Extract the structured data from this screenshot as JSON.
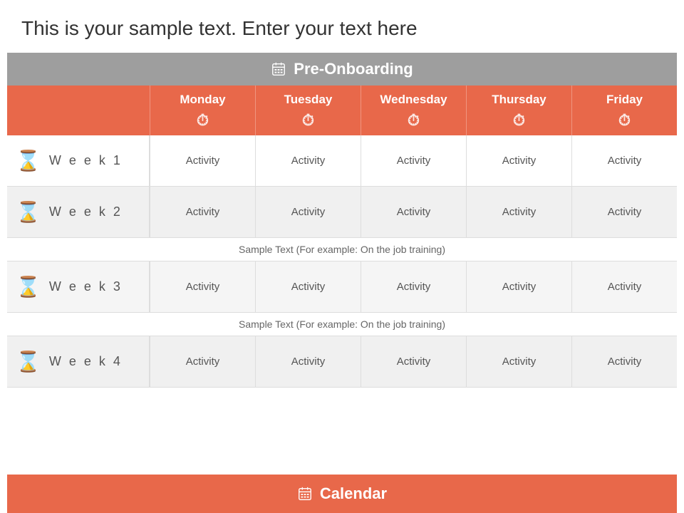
{
  "sample_text": "This is your sample text. Enter your text here",
  "header": {
    "label": "Pre-Onboarding"
  },
  "days": [
    {
      "name": "Monday"
    },
    {
      "name": "Tuesday"
    },
    {
      "name": "Wednesday"
    },
    {
      "name": "Thursday"
    },
    {
      "name": "Friday"
    }
  ],
  "weeks": [
    {
      "label": "W e e k  1",
      "activities": [
        "Activity",
        "Activity",
        "Activity",
        "Activity",
        "Activity"
      ],
      "sample_text": null
    },
    {
      "label": "W e e k  2",
      "activities": [
        "Activity",
        "Activity",
        "Activity",
        "Activity",
        "Activity"
      ],
      "sample_text": "Sample Text (For example: On the job training)"
    },
    {
      "label": "W e e k  3",
      "activities": [
        "Activity",
        "Activity",
        "Activity",
        "Activity",
        "Activity"
      ],
      "sample_text": "Sample Text (For example: On the job training)"
    },
    {
      "label": "W e e k  4",
      "activities": [
        "Activity",
        "Activity",
        "Activity",
        "Activity",
        "Activity"
      ],
      "sample_text": null
    }
  ],
  "footer": {
    "label": "Calendar"
  }
}
